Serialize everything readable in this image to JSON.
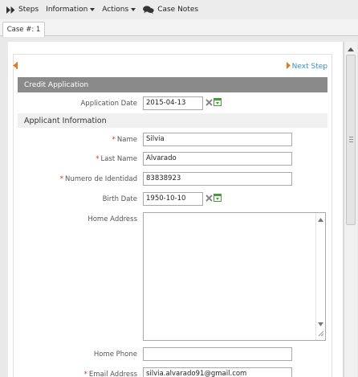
{
  "toolbar": {
    "steps_label": "Steps",
    "information_label": "Information",
    "actions_label": "Actions",
    "case_notes_label": "Case Notes"
  },
  "tabs": [
    {
      "label": "Case #: 1"
    }
  ],
  "nav": {
    "next_step_label": "Next Step"
  },
  "form": {
    "section_title": "Credit Application",
    "application_date": {
      "label": "Application Date",
      "value": "2015-04-13"
    },
    "applicant_section_title": "Applicant Information",
    "name": {
      "label": "Name",
      "value": "Silvia",
      "required": true
    },
    "last_name": {
      "label": "Last Name",
      "value": "Alvarado",
      "required": true
    },
    "numero_identidad": {
      "label": "Numero de Identidad",
      "value": "83838923",
      "required": true
    },
    "birth_date": {
      "label": "Birth Date",
      "value": "1950-10-10"
    },
    "home_address": {
      "label": "Home Address",
      "value": ""
    },
    "home_phone": {
      "label": "Home Phone",
      "value": ""
    },
    "email_address": {
      "label": "Email Address",
      "value": "silvia.alvarado91@gmail.com",
      "required": true
    },
    "required_marker": "*"
  },
  "colors": {
    "section_header_bg": "#8a8a8a",
    "link": "#3a8fc9",
    "required": "#d0312d"
  }
}
